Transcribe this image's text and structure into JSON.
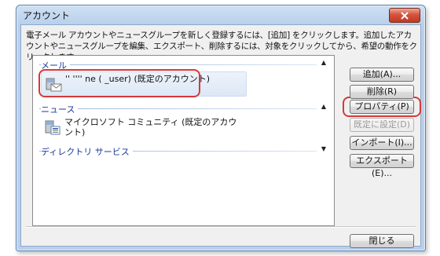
{
  "window": {
    "title": "アカウント",
    "description": "電子メール アカウントやニュースグループを新しく登録するには、[追加] をクリックします。追加したアカウントやニュースグループを編集、エクスポート、削除するには、対象をクリックしてから、希望の動作をクリックします。"
  },
  "groups": {
    "mail": {
      "label": "メール",
      "account_label": "'' '''' ne (    _user) (既定のアカウント)"
    },
    "news": {
      "label": "ニュース",
      "account_label": "マイクロソフト コミュニティ (既定のアカウント)"
    },
    "directory": {
      "label": "ディレクトリ サービス"
    }
  },
  "buttons": {
    "add": "追加(A)...",
    "remove": "削除(R)",
    "properties": "プロパティ(P)",
    "set_default": "既定に設定(D)",
    "import": "インポート(I)...",
    "export": "エクスポート(E)...",
    "close": "閉じる"
  },
  "icons": {
    "mail_account": "mail-account-icon",
    "news_account": "news-account-icon",
    "close": "close-icon",
    "collapse": "chevron-up-icon",
    "expand": "chevron-down-icon"
  },
  "colors": {
    "highlight": "#d43a3a",
    "group_label": "#1a3a9a",
    "close_button": "#c23a22"
  }
}
